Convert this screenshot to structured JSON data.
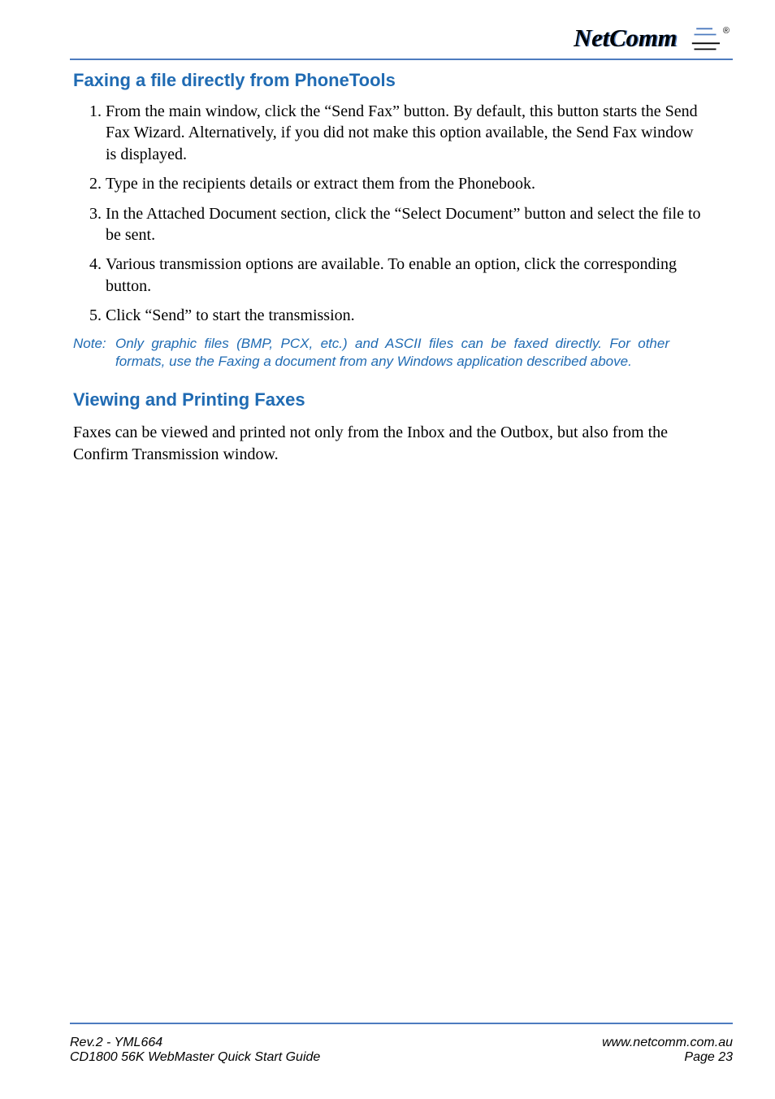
{
  "brand": {
    "name": "NetComm",
    "registered": "®"
  },
  "section1": {
    "title": "Faxing a file directly from PhoneTools",
    "steps": [
      "From the main window, click the “Send Fax” button.  By default, this button starts the Send Fax Wizard.  Alternatively, if you did not make this option available, the Send Fax window is displayed.",
      "Type in the recipients details or extract them from the Phonebook.",
      "In the Attached Document section, click the “Select Document” button and select the file to be sent.",
      "Various transmission options are available. To enable an option, click the corresponding button.",
      "Click “Send” to start the transmission."
    ],
    "note_label": "Note:",
    "note_body": "Only graphic files (BMP, PCX, etc.) and ASCII files can be faxed directly. For other formats, use the Faxing a document from any Windows application described above."
  },
  "section2": {
    "title": "Viewing and Printing Faxes",
    "body": "Faxes can be viewed and printed not only from the Inbox and the Outbox, but also from the Confirm Transmission window."
  },
  "footer": {
    "left1": "Rev.2 - YML664",
    "left2": "CD1800 56K WebMaster Quick Start Guide",
    "right1": "www.netcomm.com.au",
    "right2": "Page 23"
  }
}
